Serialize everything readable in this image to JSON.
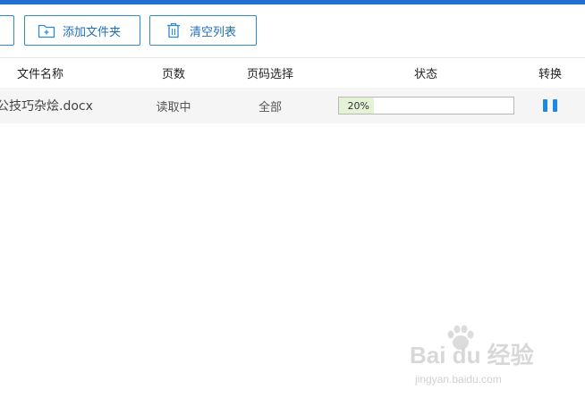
{
  "toolbar": {
    "add_folder_label": "添加文件夹",
    "clear_list_label": "清空列表"
  },
  "table": {
    "columns": {
      "name": "文件名称",
      "pages": "页数",
      "page_range": "页码选择",
      "status": "状态",
      "convert": "转换"
    },
    "rows": [
      {
        "name": "公技巧杂烩.docx",
        "pages": "读取中",
        "page_range": "全部",
        "progress_text": "20%",
        "progress": 0.2,
        "action_icon": "pause-icon"
      }
    ]
  },
  "watermark": {
    "main": "Bai du 经验",
    "sub": "jingyan.baidu.com"
  },
  "colors": {
    "accent": "#1f6fd6",
    "button_border": "#2d8ad6",
    "progress_fill": "#e4f3d6",
    "pause": "#1e88e5"
  },
  "icons": [
    "add-folder-icon",
    "trash-icon",
    "pause-icon",
    "baidu-paw-icon"
  ]
}
